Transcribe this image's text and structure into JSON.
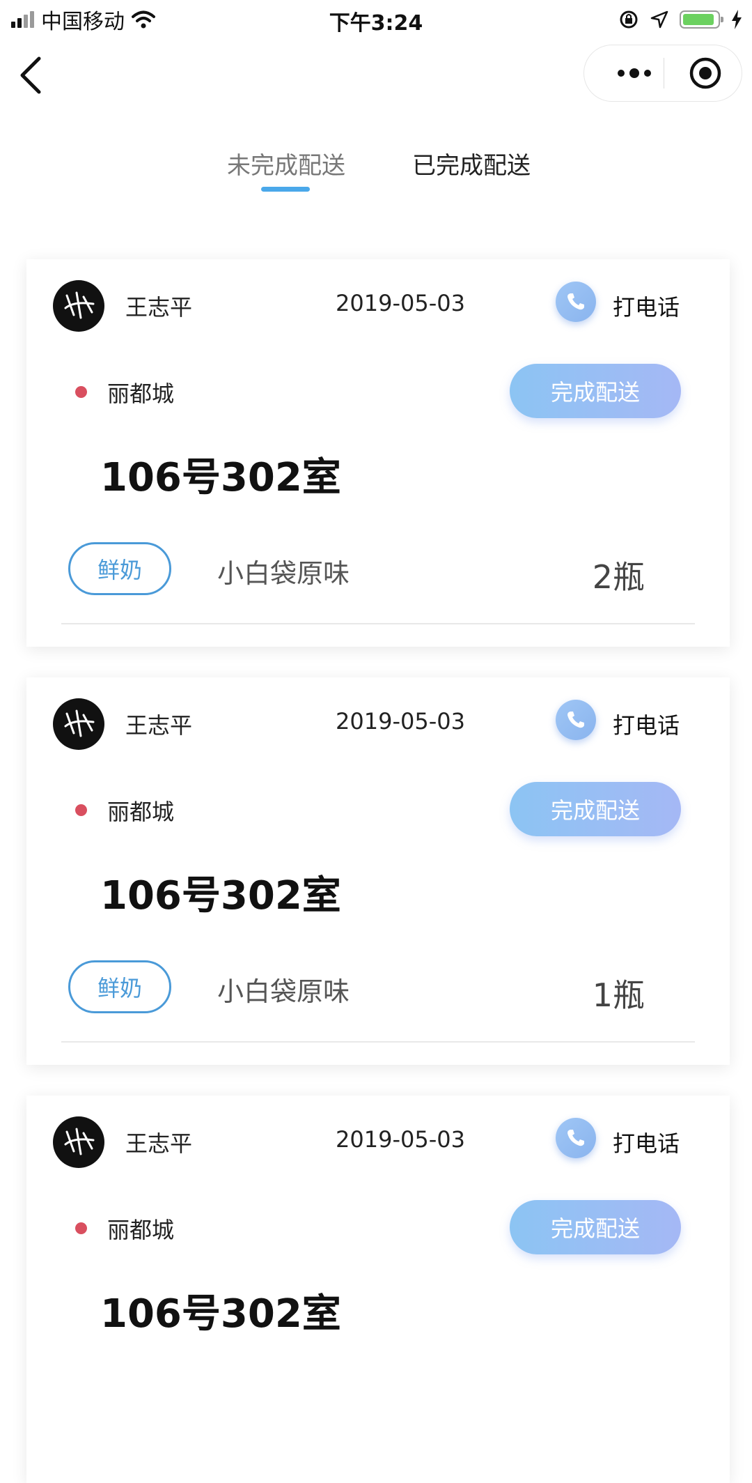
{
  "status_bar": {
    "carrier": "中国移动",
    "time": "下午3:24"
  },
  "tabs": [
    {
      "label": "未完成配送",
      "active": true
    },
    {
      "label": "已完成配送",
      "active": false
    }
  ],
  "colors": {
    "accent": "#4aa8ea",
    "button_gradient_start": "#8cc4f3",
    "button_gradient_end": "#a5b8f5",
    "dot": "#d94f5f",
    "tag_border": "#4a9ad8",
    "battery": "#6cd160"
  },
  "orders": [
    {
      "customer": "王志平",
      "date": "2019-05-03",
      "call_label": "打电话",
      "community": "丽都城",
      "complete_label": "完成配送",
      "room": "106号302室",
      "category": "鲜奶",
      "product": "小白袋原味",
      "quantity": "2瓶"
    },
    {
      "customer": "王志平",
      "date": "2019-05-03",
      "call_label": "打电话",
      "community": "丽都城",
      "complete_label": "完成配送",
      "room": "106号302室",
      "category": "鲜奶",
      "product": "小白袋原味",
      "quantity": "1瓶"
    },
    {
      "customer": "王志平",
      "date": "2019-05-03",
      "call_label": "打电话",
      "community": "丽都城",
      "complete_label": "完成配送",
      "room": "106号302室"
    }
  ]
}
